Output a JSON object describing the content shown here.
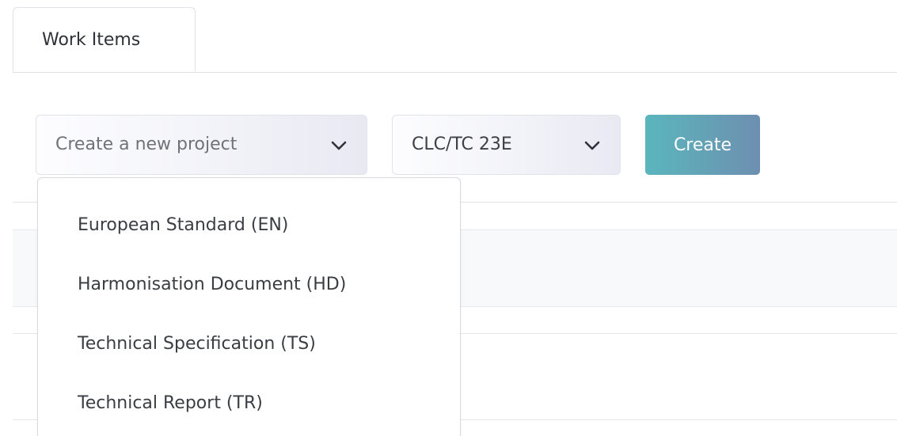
{
  "tabs": [
    {
      "label": "Work Items"
    }
  ],
  "toolbar": {
    "project_type_select": {
      "placeholder": "Create a new project",
      "options": [
        "European Standard (EN)",
        "Harmonisation Document (HD)",
        "Technical Specification (TS)",
        "Technical Report (TR)"
      ]
    },
    "committee_select": {
      "value": "CLC/TC 23E"
    },
    "create_button": {
      "label": "Create"
    }
  },
  "icons": {
    "chevron": "chevron-down-icon"
  },
  "colors": {
    "create_button_gradient_start": "#5ab6bd",
    "create_button_gradient_end": "#6e8fb0"
  }
}
